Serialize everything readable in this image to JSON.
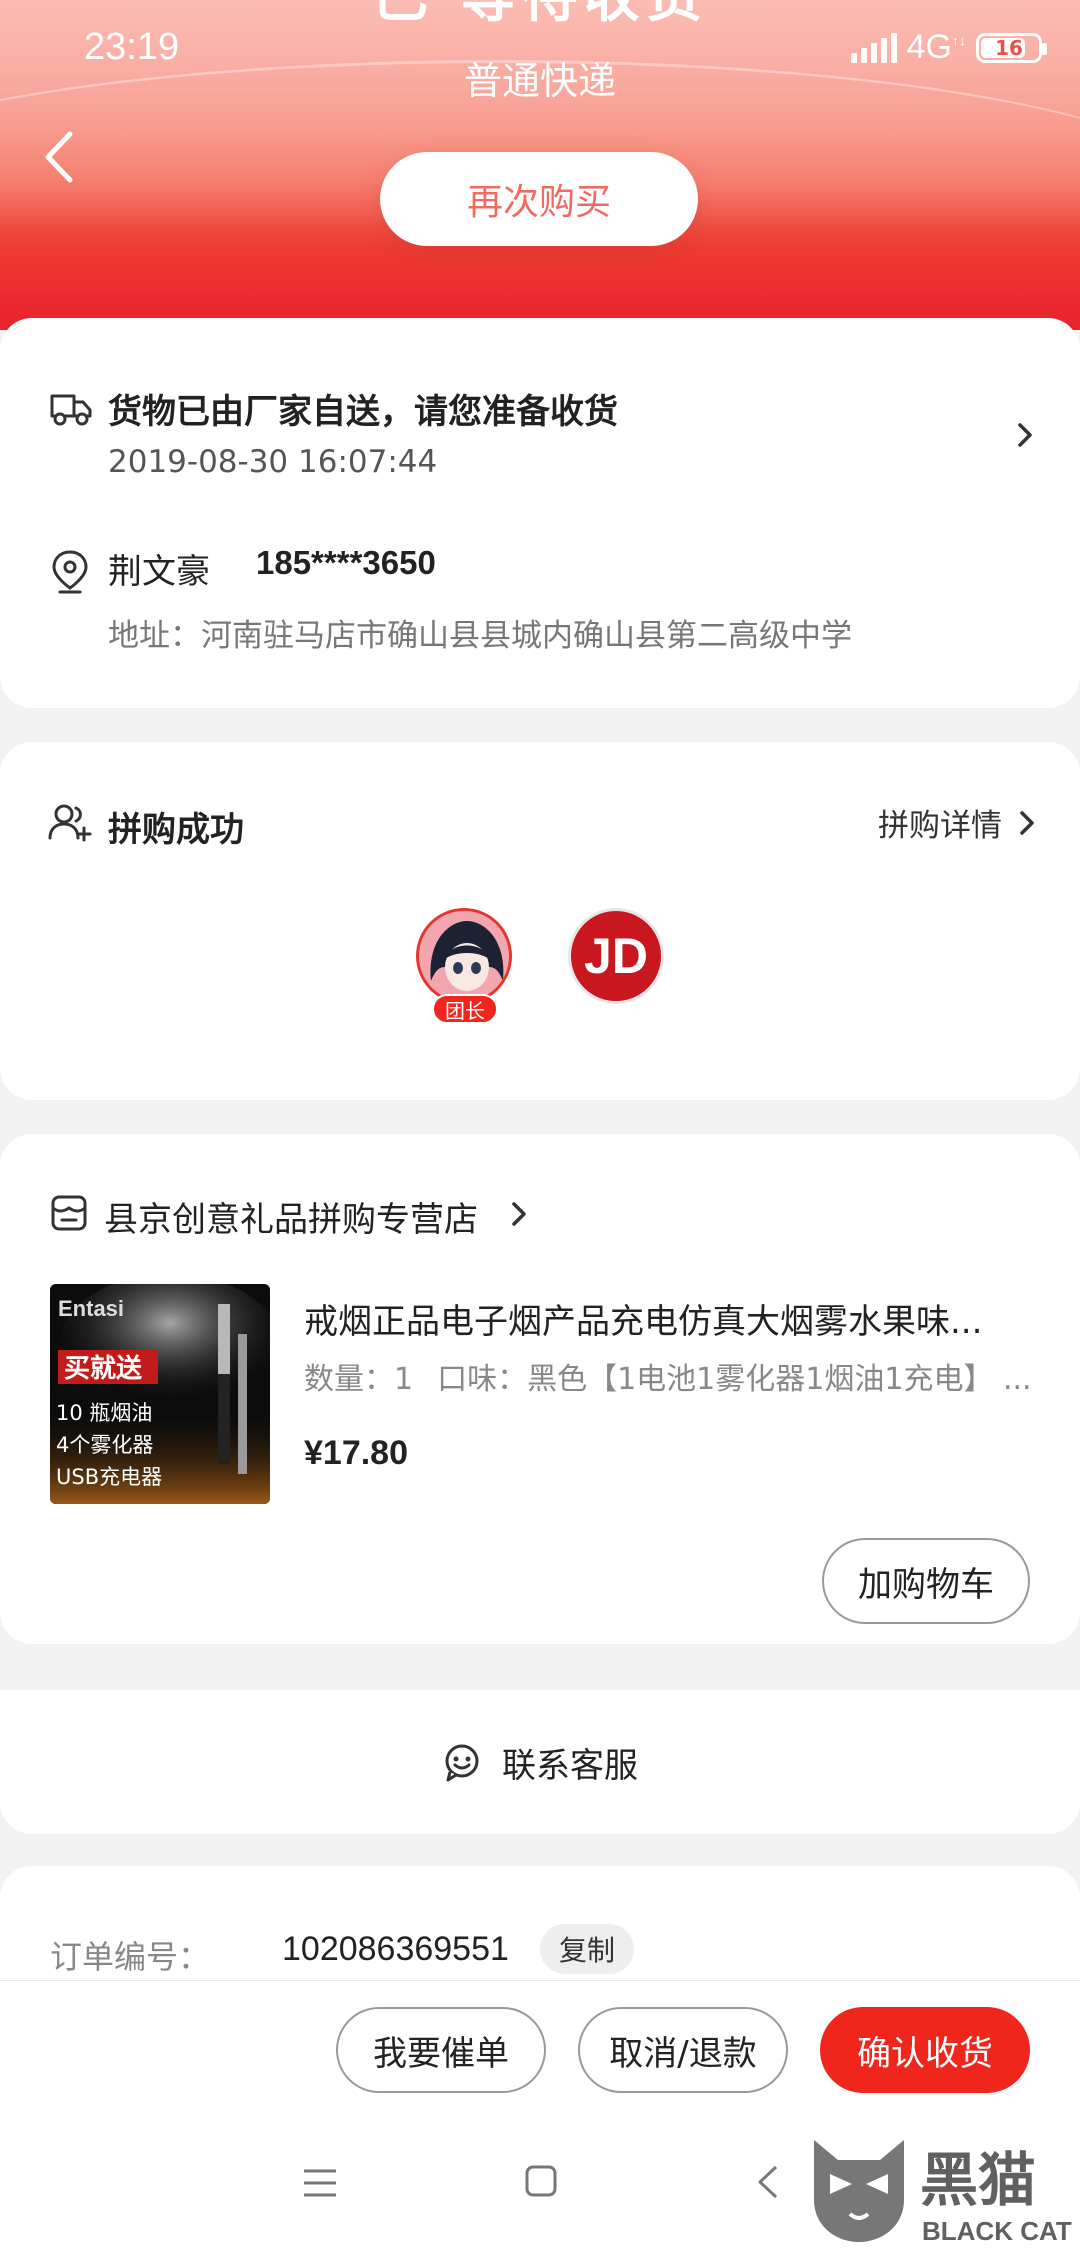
{
  "status_bar": {
    "time": "23:19",
    "network": "4G",
    "battery": "16"
  },
  "header": {
    "title_partial": "已 等待收货",
    "subtitle": "普通快递",
    "rebuy_label": "再次购买"
  },
  "logistics": {
    "message": "货物已由厂家自送，请您准备收货",
    "timestamp": "2019-08-30 16:07:44"
  },
  "address": {
    "name": "荆文豪",
    "phone": "185****3650",
    "address": "地址：河南驻马店市确山县县城内确山县第二高级中学"
  },
  "group_buy": {
    "title": "拼购成功",
    "detail_link": "拼购详情",
    "leader_badge": "团长",
    "jd_logo_text": "JD"
  },
  "shop": {
    "name": "县京创意礼品拼购专营店",
    "product": {
      "title": "戒烟正品电子烟产品充电仿真大烟雾水果味...",
      "quantity": "数量：1",
      "spec": "口味：黑色【1电池1雾化器1烟油1充电】 ...",
      "price": "¥17.80",
      "image_texts": {
        "brand": "Entasi",
        "promo": "买就送",
        "line1": "10 瓶烟油",
        "line2": "4个雾化器",
        "line3": "USB充电器"
      }
    },
    "add_cart_label": "加购物车"
  },
  "service": {
    "contact_label": "联系客服"
  },
  "order": {
    "number_label": "订单编号：",
    "number": "102086369551",
    "copy_label": "复制"
  },
  "action_bar": {
    "urge_label": "我要催单",
    "cancel_label": "取消/退款",
    "confirm_label": "确认收货"
  },
  "watermark": {
    "cn": "黑猫",
    "en": "BLACK CAT"
  },
  "colors": {
    "accent": "#f0251c",
    "header_top": "#f7a29a",
    "header_bottom": "#e8222c"
  }
}
